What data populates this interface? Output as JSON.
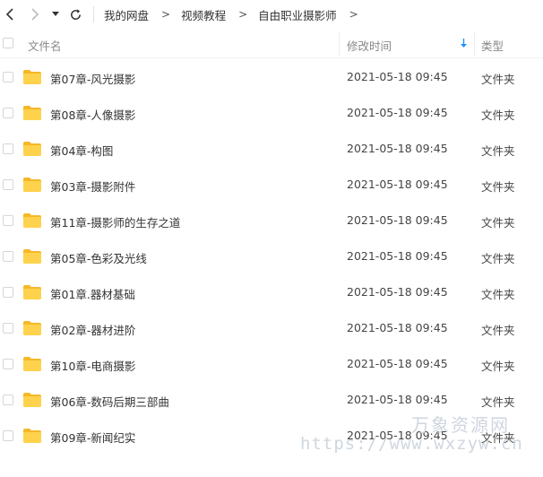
{
  "breadcrumb": {
    "items": [
      "我的网盘",
      "视频教程",
      "自由职业摄影师"
    ],
    "separator": ">"
  },
  "header": {
    "name": "文件名",
    "time": "修改时间",
    "type": "类型"
  },
  "files": [
    {
      "name": "第07章-风光摄影",
      "time": "2021-05-18 09:45",
      "type": "文件夹"
    },
    {
      "name": "第08章-人像摄影",
      "time": "2021-05-18 09:45",
      "type": "文件夹"
    },
    {
      "name": "第04章-构图",
      "time": "2021-05-18 09:45",
      "type": "文件夹"
    },
    {
      "name": "第03章-摄影附件",
      "time": "2021-05-18 09:45",
      "type": "文件夹"
    },
    {
      "name": "第11章-摄影师的生存之道",
      "time": "2021-05-18 09:45",
      "type": "文件夹"
    },
    {
      "name": "第05章-色彩及光线",
      "time": "2021-05-18 09:45",
      "type": "文件夹"
    },
    {
      "name": "第01章.器材基础",
      "time": "2021-05-18 09:45",
      "type": "文件夹"
    },
    {
      "name": "第02章-器材进阶",
      "time": "2021-05-18 09:45",
      "type": "文件夹"
    },
    {
      "name": "第10章-电商摄影",
      "time": "2021-05-18 09:45",
      "type": "文件夹"
    },
    {
      "name": "第06章-数码后期三部曲",
      "time": "2021-05-18 09:45",
      "type": "文件夹"
    },
    {
      "name": "第09章-新闻纪实",
      "time": "2021-05-18 09:45",
      "type": "文件夹"
    }
  ],
  "watermark": {
    "text": "万象资源网",
    "url": "https://www.wxzyw.cn"
  },
  "colors": {
    "folder": "#FFD24D",
    "folder_tab": "#F5B829",
    "sort_accent": "#1E90FF"
  }
}
